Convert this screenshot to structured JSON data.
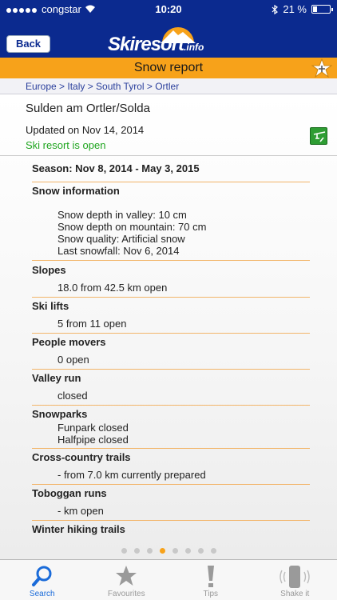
{
  "status_bar": {
    "carrier": "congstar",
    "time": "10:20",
    "battery": "21 %",
    "battery_level": 0.21
  },
  "header": {
    "back_label": "Back",
    "logo_text": "Skiresort",
    "logo_suffix": ".info",
    "brand_color": "#0b2a8f",
    "accent_color": "#f7a21a"
  },
  "title_bar": {
    "title": "Snow report",
    "star_icon": "star-plus-icon"
  },
  "breadcrumb": "Europe > Italy > South Tyrol > Ortler",
  "resort": {
    "name": "Sulden am Ortler/Solda",
    "updated": "Updated on Nov 14, 2014",
    "status": "Ski resort is open",
    "status_color": "#1fa51f"
  },
  "report": {
    "season": "Season: Nov 8, 2014 - May 3, 2015",
    "snow_info_title": "Snow information",
    "snow_valley": "Snow depth in valley:      10 cm",
    "snow_mountain": "Snow depth on mountain:         70 cm",
    "snow_quality": "Snow quality:  Artificial snow",
    "last_snowfall": "Last snowfall:  Nov 6, 2014",
    "slopes_title": "Slopes",
    "slopes_value": "18.0 from 42.5 km open",
    "lifts_title": "Ski lifts",
    "lifts_value": "5 from 11 open",
    "people_movers_title": "People movers",
    "people_movers_value": "0 open",
    "valley_run_title": "Valley run",
    "valley_run_value": "closed",
    "snowparks_title": "Snowparks",
    "funpark": "Funpark closed",
    "halfpipe": "Halfpipe closed",
    "crosscountry_title": "Cross-country trails",
    "crosscountry_value": "- from 7.0 km currently prepared",
    "toboggan_title": "Toboggan runs",
    "toboggan_value": "- km open",
    "winter_hiking_title": "Winter hiking trails"
  },
  "pager": {
    "count": 8,
    "active_index": 3
  },
  "tabs": [
    {
      "label": "Search",
      "icon": "search-icon"
    },
    {
      "label": "Favourites",
      "icon": "star-icon"
    },
    {
      "label": "Tips",
      "icon": "exclamation-icon"
    },
    {
      "label": "Shake it",
      "icon": "shake-phone-icon"
    }
  ]
}
